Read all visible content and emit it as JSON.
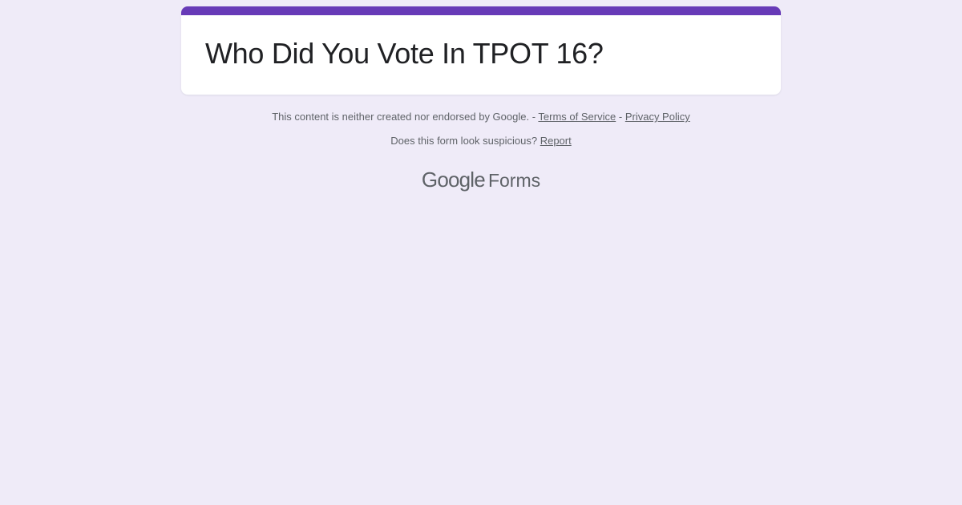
{
  "form": {
    "title": "Who Did You Vote In TPOT 16?"
  },
  "footer": {
    "disclaimer_text": "This content is neither created nor endorsed by Google. -",
    "separator": "-",
    "terms_label": "Terms of Service",
    "privacy_label": "Privacy Policy",
    "suspicious_text": "Does this form look suspicious?",
    "report_label": "Report"
  },
  "brand": {
    "google": "Google",
    "product": "Forms"
  },
  "colors": {
    "background": "#efebf8",
    "accent": "#673ab7",
    "card": "#ffffff",
    "text": "#202124",
    "muted_text": "#5f6368"
  }
}
